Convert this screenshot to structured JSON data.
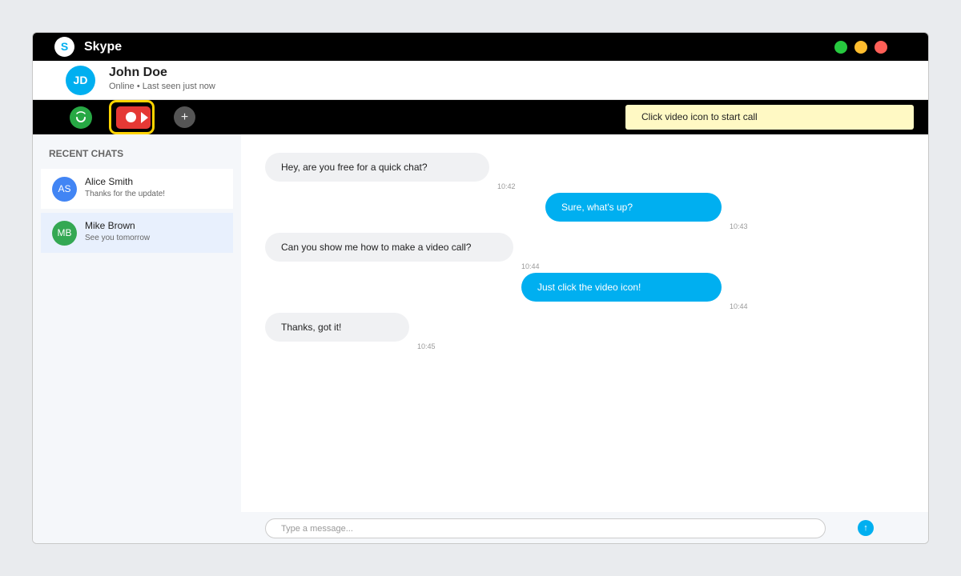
{
  "app": {
    "logo": "S",
    "title": "Skype"
  },
  "window_controls": [
    "green",
    "yellow",
    "red"
  ],
  "contact": {
    "initials": "JD",
    "name": "John Doe",
    "status": "Online • Last seen just now"
  },
  "toolbar": {
    "call_icon": "phone-icon",
    "video_icon": "video-camera-icon",
    "add_icon": "plus-icon",
    "add_label": "+",
    "hint": "Click video icon to start call"
  },
  "sidebar": {
    "heading": "RECENT CHATS",
    "chats": [
      {
        "initials": "AS",
        "name": "Alice Smith",
        "preview": "Thanks for the update!",
        "color": "#4285f4"
      },
      {
        "initials": "MB",
        "name": "Mike Brown",
        "preview": "See you tomorrow",
        "color": "#34a853",
        "selected": true
      }
    ]
  },
  "messages": [
    {
      "direction": "in",
      "text": "Hey, are you free for a quick chat?",
      "time": "10:42"
    },
    {
      "direction": "out",
      "text": "Sure, what's up?",
      "time": "10:43"
    },
    {
      "direction": "in",
      "text": "Can you show me how to make a video call?",
      "time": "10:44"
    },
    {
      "direction": "out",
      "text": "Just click the video icon!",
      "time": "10:44"
    },
    {
      "direction": "in",
      "text": "Thanks, got it!",
      "time": "10:45"
    }
  ],
  "composer": {
    "placeholder": "Type a message...",
    "value": "",
    "send_label": "↑"
  },
  "colors": {
    "accent": "#00aff0",
    "titlebar": "#000000",
    "video_button": "#e53935",
    "highlight": "#ffd400",
    "hint_bg": "#fff9c4"
  }
}
